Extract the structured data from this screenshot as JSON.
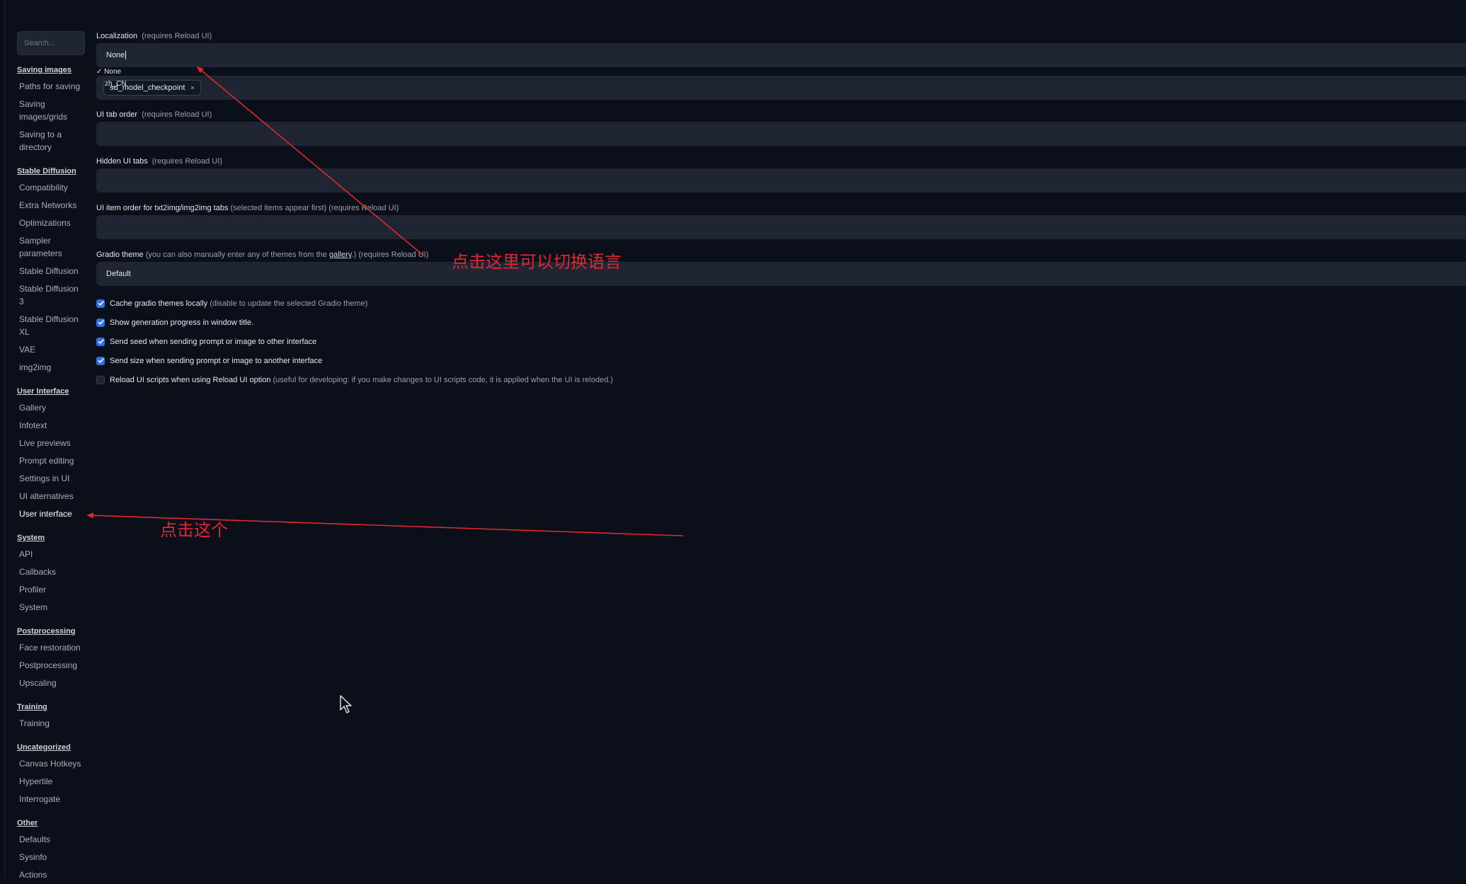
{
  "sidebar": {
    "search_placeholder": "Search...",
    "sections": [
      {
        "title": "Saving images",
        "items": [
          "Paths for saving",
          "Saving images/grids",
          "Saving to a directory"
        ]
      },
      {
        "title": "Stable Diffusion",
        "items": [
          "Compatibility",
          "Extra Networks",
          "Optimizations",
          "Sampler parameters",
          "Stable Diffusion",
          "Stable Diffusion 3",
          "Stable Diffusion XL",
          "VAE",
          "img2img"
        ]
      },
      {
        "title": "User Interface",
        "items": [
          "Gallery",
          "Infotext",
          "Live previews",
          "Prompt editing",
          "Settings in UI",
          "UI alternatives",
          "User interface"
        ]
      },
      {
        "title": "System",
        "items": [
          "API",
          "Callbacks",
          "Profiler",
          "System"
        ]
      },
      {
        "title": "Postprocessing",
        "items": [
          "Face restoration",
          "Postprocessing",
          "Upscaling"
        ]
      },
      {
        "title": "Training",
        "items": [
          "Training"
        ]
      },
      {
        "title": "Uncategorized",
        "items": [
          "Canvas Hotkeys",
          "Hypertile",
          "Interrogate"
        ]
      },
      {
        "title": "Other",
        "items": [
          "Defaults",
          "Sysinfo",
          "Actions"
        ]
      }
    ],
    "active_item": "User interface"
  },
  "settings": {
    "localization": {
      "label": "Localization",
      "note": "(requires Reload UI)",
      "value": "None"
    },
    "localization_options": {
      "selected_mark": "✓",
      "options": [
        "None",
        "zh_CN"
      ]
    },
    "quicksettings": {
      "chip": "sd_model_checkpoint",
      "chip_remove": "×"
    },
    "ui_tab_order": {
      "label": "UI tab order",
      "note": "(requires Reload UI)"
    },
    "hidden_ui_tabs": {
      "label": "Hidden UI tabs",
      "note": "(requires Reload UI)"
    },
    "ui_item_order": {
      "label": "UI item order for txt2img/img2img tabs",
      "note": "(selected items appear first) (requires Reload UI)"
    },
    "gradio_theme": {
      "label": "Gradio theme",
      "note_before": "(you can also manually enter any of themes from the",
      "link": "gallery",
      "note_after": ".) (requires Reload UI)",
      "value": "Default"
    },
    "checkboxes": [
      {
        "label": "Cache gradio themes locally",
        "note": "(disable to update the selected Gradio theme)",
        "checked": true
      },
      {
        "label": "Show generation progress in window title.",
        "note": "",
        "checked": true
      },
      {
        "label": "Send seed when sending prompt or image to other interface",
        "note": "",
        "checked": true
      },
      {
        "label": "Send size when sending prompt or image to another interface",
        "note": "",
        "checked": true
      },
      {
        "label": "Reload UI scripts when using Reload UI option",
        "note": "(useful for developing: if you make changes to UI scripts code, it is applied when the UI is reloded.)",
        "checked": false
      }
    ]
  },
  "annotations": {
    "language_hint": "点击这里可以切换语言",
    "click_hint": "点击这个",
    "color": "#e0282e"
  },
  "colors": {
    "background": "#0b0f19",
    "field": "#1f2533",
    "checkbox_on": "#2f6fe8"
  }
}
